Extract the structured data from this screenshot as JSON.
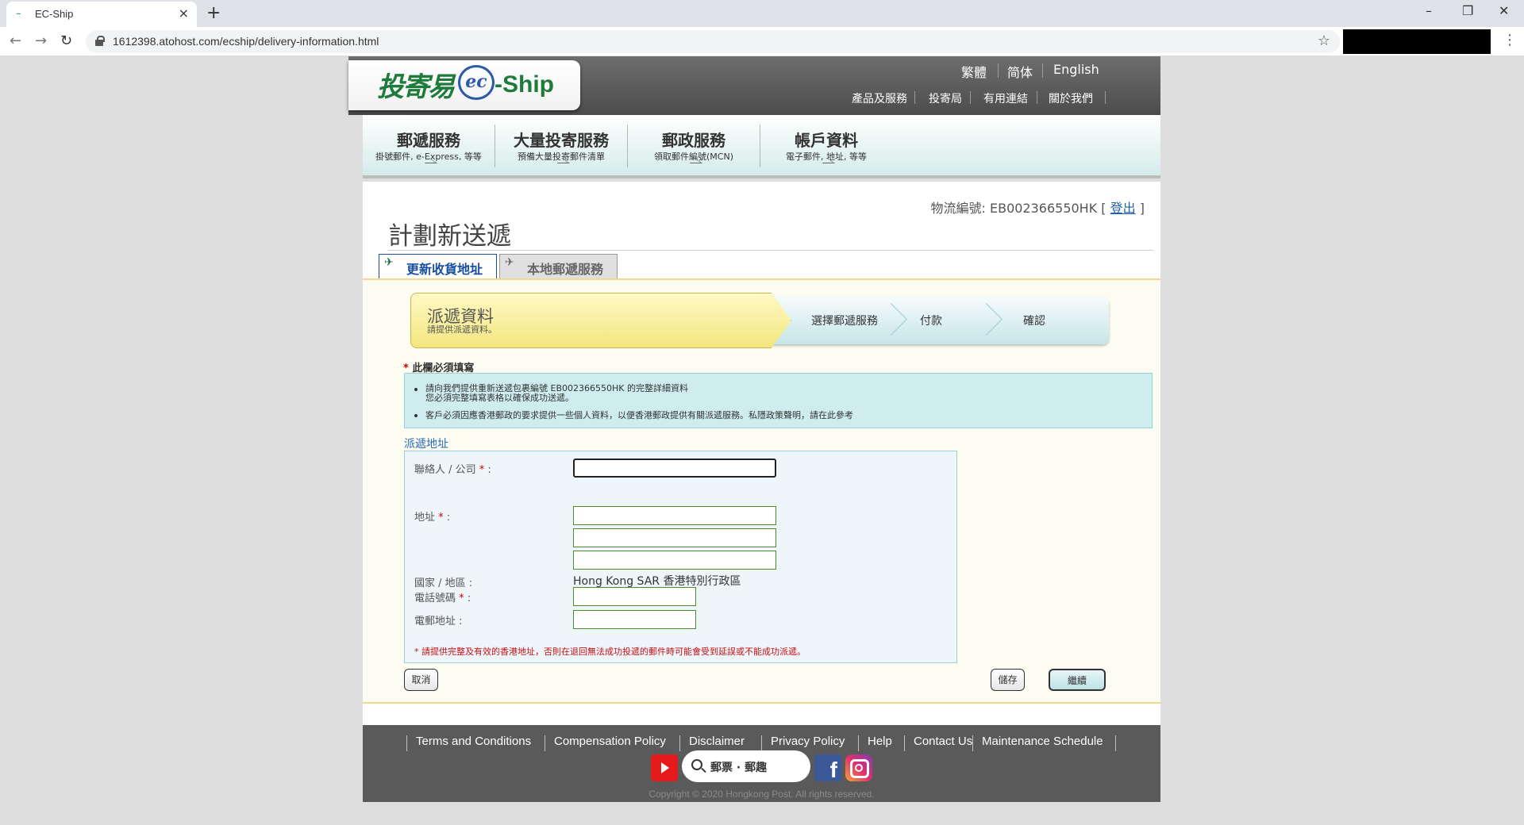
{
  "browser": {
    "tab_title": "EC-Ship",
    "url": "1612398.atohost.com/ecship/delivery-information.html"
  },
  "header": {
    "logo": {
      "cn": "投寄易",
      "ec": "ec",
      "ship": "-Ship"
    },
    "languages": [
      "繁體",
      "简体",
      "English"
    ],
    "top_links": [
      "產品及服務",
      "投寄局",
      "有用連結",
      "關於我們"
    ]
  },
  "main_nav": [
    {
      "title": "郵遞服務",
      "subtitle": "掛號郵件, e-Express, 等等"
    },
    {
      "title": "大量投寄服務",
      "subtitle": "預備大量投寄郵件清單"
    },
    {
      "title": "郵政服務",
      "subtitle": "領取郵件編號(MCN)"
    },
    {
      "title": "帳戶資料",
      "subtitle": "電子郵件, 地址, 等等"
    }
  ],
  "account": {
    "ref_label": "物流編號: EB002366550HK [",
    "logout": "登出",
    "ref_suffix": "]"
  },
  "page": {
    "title": "計劃新送遞",
    "tabs": [
      "更新收貨地址",
      "本地郵遞服務"
    ]
  },
  "steps": {
    "current_title": "派遞資料",
    "current_subtitle": "請提供派遞資料。",
    "next": [
      "選擇郵遞服務",
      "付款",
      "確認"
    ]
  },
  "required_note": {
    "star": "*",
    "text": " 此欄必須填寫"
  },
  "info": {
    "line1": "請向我們提供重新送遞包裹編號 EB002366550HK 的完整詳細資料",
    "line2": "您必須完整填寫表格以確保成功送遞。",
    "line3": "客戶必須因應香港郵政的要求提供一些個人資料，以便香港郵政提供有關派遞服務。私隱政策聲明，請在此參考"
  },
  "form": {
    "section_title": "派遞地址",
    "contact_label": "聯絡人 / 公司",
    "address_label": "地址",
    "country_label": "國家 / 地區 :",
    "country_value": "Hong Kong SAR 香港特別行政區",
    "phone_label": "電話號碼",
    "email_label": "電郵地址 :",
    "star": "*",
    "colon": " :",
    "contact_value": "",
    "address_line1": "",
    "address_line2": "",
    "address_line3": "",
    "phone_value": "",
    "email_value": "",
    "warning": "* 請提供完整及有效的香港地址，否則在退回無法成功投遞的郵件時可能會受到延誤或不能成功派遞。"
  },
  "buttons": {
    "cancel": "取消",
    "save": "儲存",
    "continue": "繼續"
  },
  "footer": {
    "links": [
      "Terms and Conditions",
      "Compensation Policy",
      "Disclaimer",
      "Privacy Policy",
      "Help",
      "Contact Us",
      "Maintenance Schedule"
    ],
    "search_text": "郵票 · 郵趣",
    "facebook_glyph": "f",
    "copyright": "Copyright © 2020 Hongkong Post. All rights reserved."
  },
  "colors": {
    "brand_green": "#1e7b3b",
    "link_blue": "#2060a8",
    "required_red": "#d40000"
  }
}
